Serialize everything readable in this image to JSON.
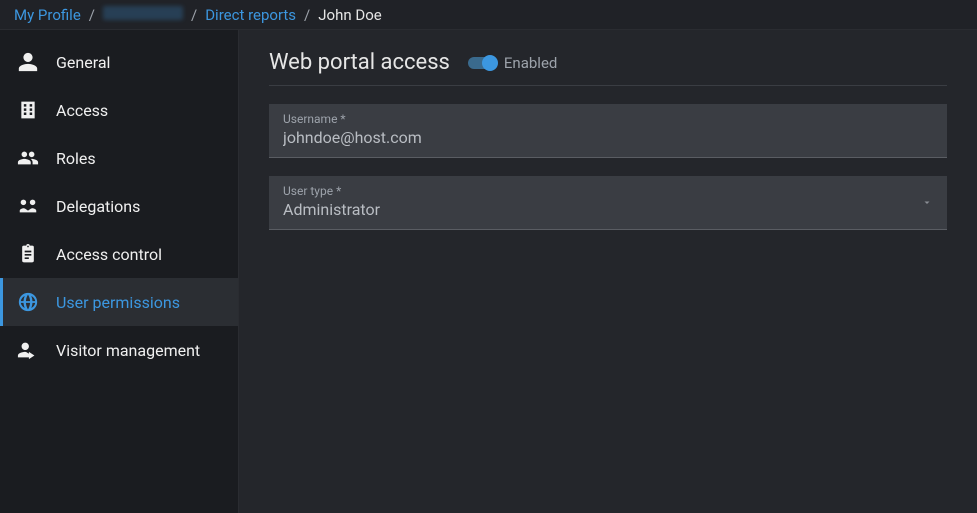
{
  "breadcrumb": {
    "root": "My Profile",
    "l2": "Direct reports",
    "current": "John Doe"
  },
  "sidebar": {
    "items": [
      {
        "label": "General",
        "icon": "person-icon"
      },
      {
        "label": "Access",
        "icon": "building-icon"
      },
      {
        "label": "Roles",
        "icon": "group-icon"
      },
      {
        "label": "Delegations",
        "icon": "handshake-icon"
      },
      {
        "label": "Access control",
        "icon": "clipboard-icon"
      },
      {
        "label": "User permissions",
        "icon": "globe-icon"
      },
      {
        "label": "Visitor management",
        "icon": "visitor-icon"
      }
    ],
    "active_index": 5
  },
  "section": {
    "title": "Web portal access",
    "toggle": {
      "enabled": true,
      "label": "Enabled"
    },
    "fields": {
      "username": {
        "label": "Username *",
        "value": "johndoe@host.com"
      },
      "usertype": {
        "label": "User type *",
        "value": "Administrator"
      }
    }
  }
}
